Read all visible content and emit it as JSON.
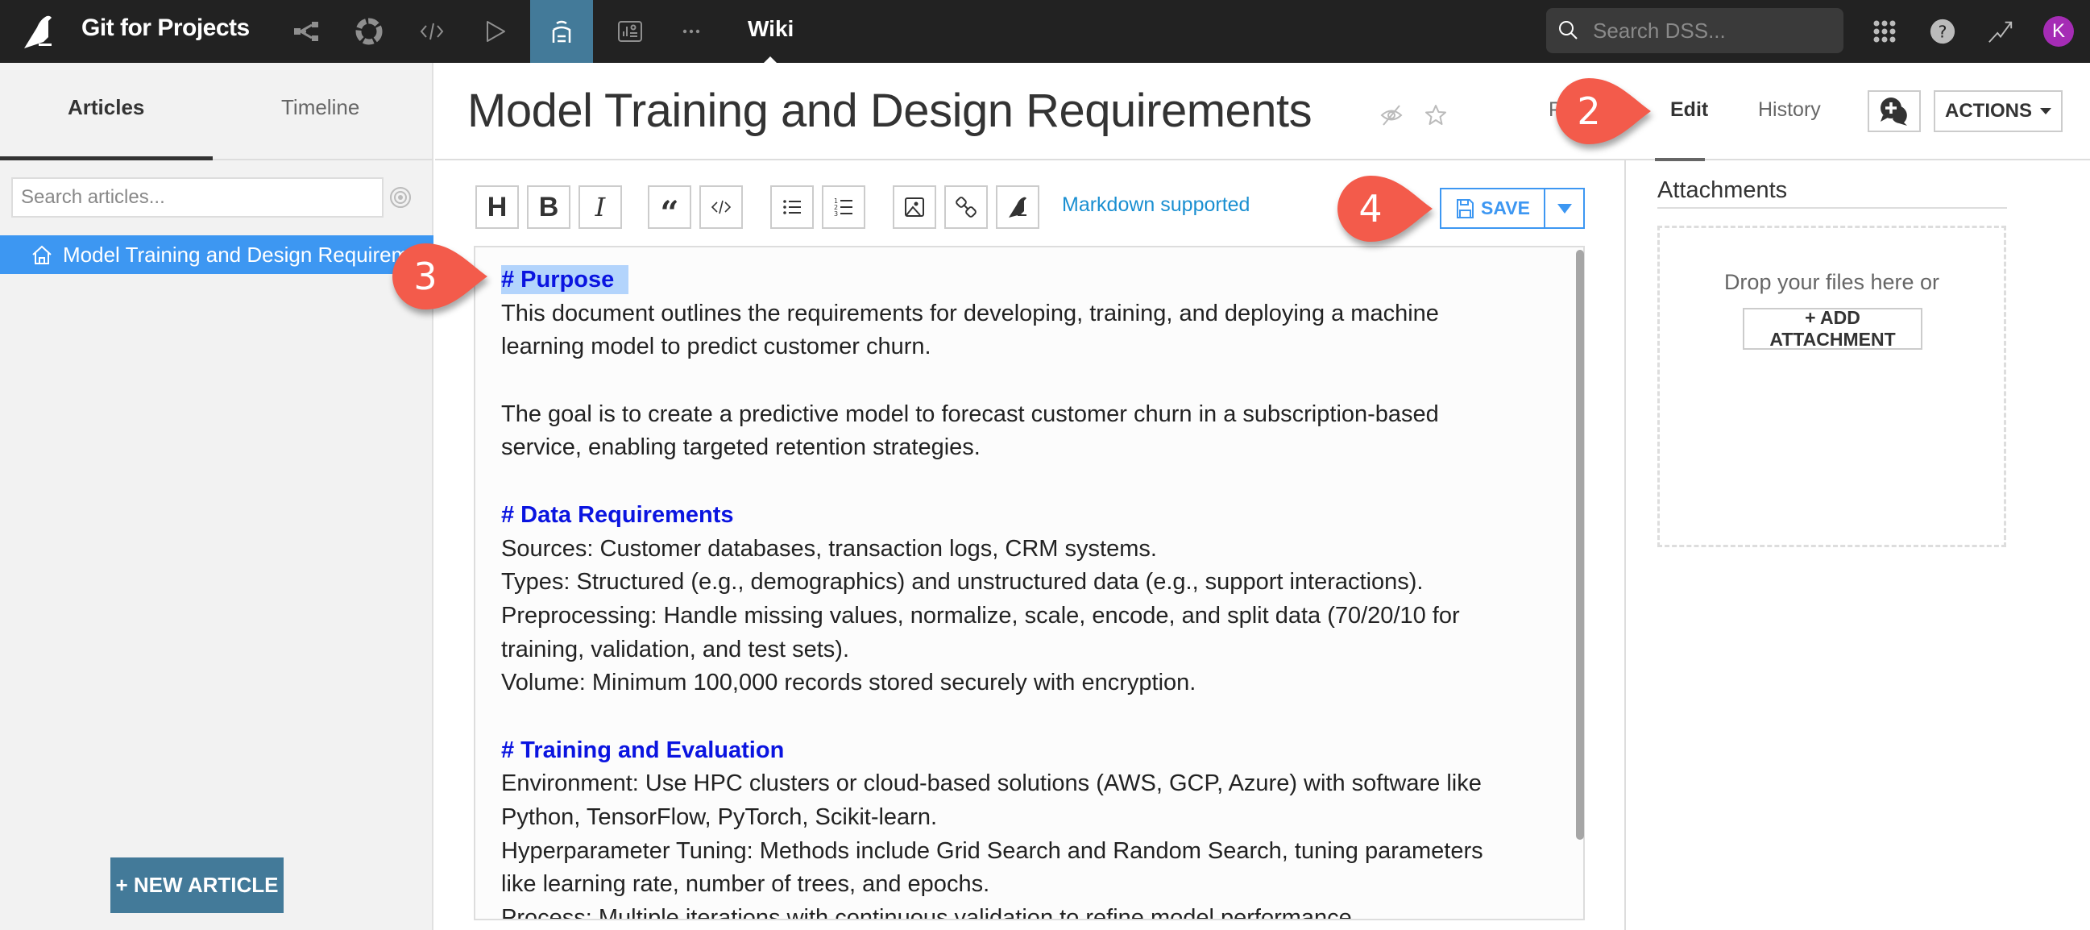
{
  "topbar": {
    "app_title": "Git for Projects",
    "nav_icons": [
      "flow-icon",
      "lab-icon",
      "code-icon",
      "run-icon",
      "wiki-notebook-icon",
      "dashboard-icon",
      "more-icon"
    ],
    "active_section": "Wiki",
    "search_placeholder": "Search DSS...",
    "avatar_initial": "K",
    "accent_color": "#437a99"
  },
  "sidebar": {
    "tabs": [
      {
        "label": "Articles",
        "active": true
      },
      {
        "label": "Timeline",
        "active": false
      }
    ],
    "search_placeholder": "Search articles...",
    "articles": [
      {
        "label": "Model Training and Design Requirements",
        "selected": true
      }
    ],
    "new_article_label": "+ NEW ARTICLE"
  },
  "header": {
    "title": "Model Training and Design Requirements",
    "view_tabs": [
      {
        "label": "P",
        "active": false
      },
      {
        "label": "Edit",
        "active": true
      },
      {
        "label": "History",
        "active": false
      }
    ],
    "actions_label": "ACTIONS"
  },
  "toolbar": {
    "buttons": [
      "heading",
      "bold",
      "italic",
      "quote",
      "code",
      "bullet-list",
      "numbered-list",
      "image",
      "link",
      "dss-object"
    ],
    "heading_glyph": "H",
    "bold_glyph": "B",
    "italic_glyph": "I",
    "quote_glyph": "“",
    "markdown_label": "Markdown supported",
    "save_label": "SAVE"
  },
  "editor": {
    "lines": [
      {
        "text": "# Purpose",
        "type": "heading",
        "selected": true
      },
      {
        "text": "This document outlines the requirements for developing, training, and deploying a machine",
        "type": "text"
      },
      {
        "text": "learning model to predict customer churn.",
        "type": "text"
      },
      {
        "text": "",
        "type": "blank"
      },
      {
        "text": "The goal is to create a predictive model to forecast customer churn in a subscription-based",
        "type": "text"
      },
      {
        "text": "service, enabling targeted retention strategies.",
        "type": "text"
      },
      {
        "text": "",
        "type": "blank"
      },
      {
        "text": "# Data Requirements",
        "type": "heading"
      },
      {
        "text": "Sources: Customer databases, transaction logs, CRM systems.",
        "type": "text"
      },
      {
        "text": "Types: Structured (e.g., demographics) and unstructured data (e.g., support interactions).",
        "type": "text"
      },
      {
        "text": "Preprocessing: Handle missing values, normalize, scale, encode, and split data (70/20/10 for",
        "type": "text"
      },
      {
        "text": "training, validation, and test sets).",
        "type": "text"
      },
      {
        "text": "Volume: Minimum 100,000 records stored securely with encryption.",
        "type": "text"
      },
      {
        "text": "",
        "type": "blank"
      },
      {
        "text": "# Training and Evaluation",
        "type": "heading"
      },
      {
        "text": "Environment: Use HPC clusters or cloud-based solutions (AWS, GCP, Azure) with software like",
        "type": "text"
      },
      {
        "text": "Python, TensorFlow, PyTorch, Scikit-learn.",
        "type": "text"
      },
      {
        "text": "Hyperparameter Tuning: Methods include Grid Search and Random Search, tuning parameters",
        "type": "text"
      },
      {
        "text": "like learning rate, number of trees, and epochs.",
        "type": "text"
      },
      {
        "text": "Process: Multiple iterations with continuous validation to refine model performance.",
        "type": "text"
      }
    ],
    "heading_color": "#0a14e0",
    "selection_color": "#b3d4fc"
  },
  "attachments": {
    "title": "Attachments",
    "drop_text": "Drop your files here or",
    "add_label": "+ ADD ATTACHMENT"
  },
  "callouts": [
    {
      "number": "2",
      "target": "Edit tab"
    },
    {
      "number": "3",
      "target": "# Purpose heading"
    },
    {
      "number": "4",
      "target": "SAVE button"
    }
  ],
  "callout_color": "#f35b4b"
}
